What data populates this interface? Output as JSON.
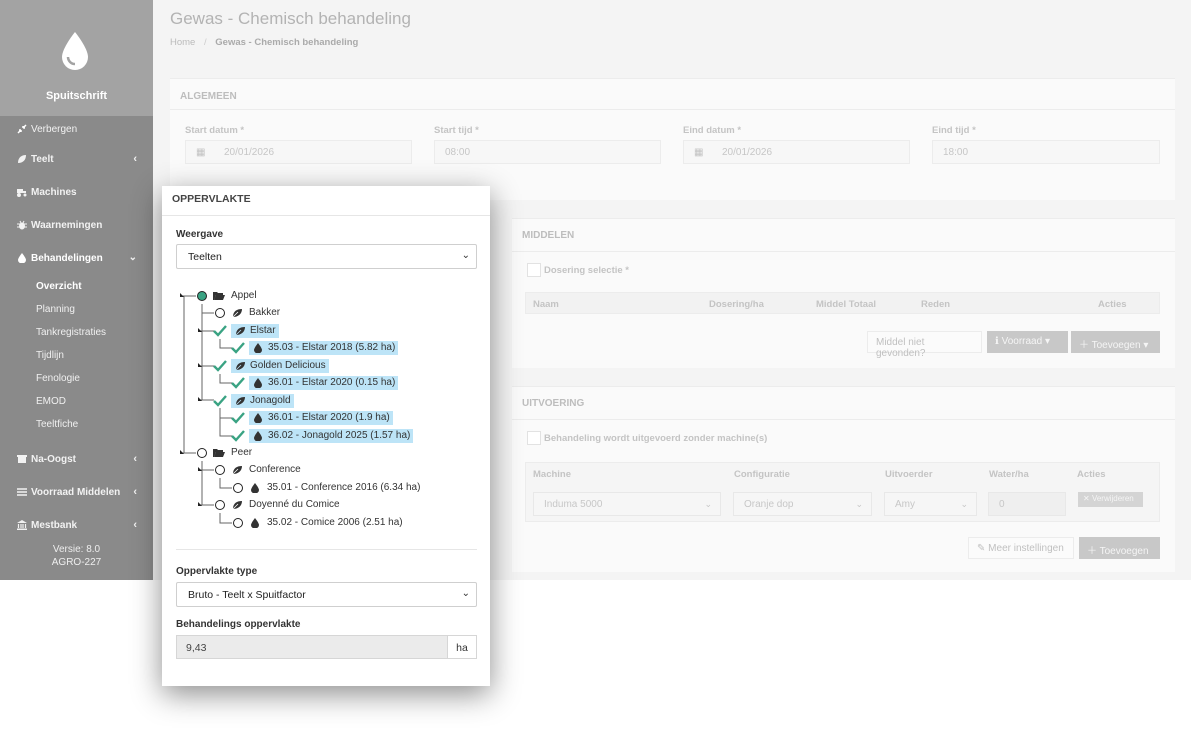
{
  "app": {
    "brand": "Spuitschrift",
    "colors": {
      "sidebar": "#8a8a8a",
      "accent": "#3aa383",
      "highlight": "#bde4f7"
    }
  },
  "sidebar": {
    "hide_label": "Verbergen",
    "items": [
      {
        "label": "Teelt",
        "icon": "leaf-icon",
        "has_children": true
      },
      {
        "label": "Machines",
        "icon": "tractor-icon",
        "has_children": false
      },
      {
        "label": "Waarnemingen",
        "icon": "bug-icon",
        "has_children": false
      },
      {
        "label": "Behandelingen",
        "icon": "drop-icon",
        "has_children": true,
        "expanded": true
      },
      {
        "label": "Na-Oogst",
        "icon": "box-icon",
        "has_children": true
      },
      {
        "label": "Voorraad Middelen",
        "icon": "list-icon",
        "has_children": true
      },
      {
        "label": "Mestbank",
        "icon": "bank-icon",
        "has_children": true
      }
    ],
    "sub_items": [
      "Overzicht",
      "Planning",
      "Tankregistraties",
      "Tijdlijn",
      "Fenologie",
      "EMOD",
      "Teeltfiche"
    ],
    "active_sub": "Overzicht",
    "version": "Versie: 8.0",
    "build": "AGRO-227"
  },
  "header": {
    "title": "Gewas - Chemisch behandeling",
    "breadcrumb_home": "Home",
    "breadcrumb_sep": "/",
    "breadcrumb_current": "Gewas - Chemisch behandeling"
  },
  "algemeen": {
    "title": "ALGEMEEN",
    "start_datum_label": "Start datum *",
    "start_datum": "20/01/2026",
    "start_tijd_label": "Start tijd *",
    "start_tijd": "08:00",
    "eind_datum_label": "Eind datum *",
    "eind_datum": "20/01/2026",
    "eind_tijd_label": "Eind tijd *",
    "eind_tijd": "18:00"
  },
  "middelen": {
    "title": "MIDDELEN",
    "dosering_selectie": "Dosering selectie *",
    "columns": [
      "Naam",
      "Dosering/ha",
      "Middel Totaal",
      "Reden",
      "Acties"
    ],
    "not_found_label": "Middel niet gevonden?",
    "voorraad_label": "Voorraad",
    "toevoegen_label": "Toevoegen"
  },
  "uitvoering": {
    "title": "UITVOERING",
    "zonder_machine": "Behandeling wordt uitgevoerd zonder machine(s)",
    "columns": [
      "Machine",
      "Configuratie",
      "Uitvoerder",
      "Water/ha",
      "Acties"
    ],
    "row": {
      "machine": "Induma 5000",
      "configuratie": "Oranje dop",
      "uitvoerder": "Amy",
      "water": "0",
      "action": "Verwijderen"
    },
    "meer_label": "Meer instellingen",
    "toevoegen_label": "Toevoegen"
  },
  "popup": {
    "title": "OPPERVLAKTE",
    "weergave_label": "Weergave",
    "weergave_value": "Teelten",
    "tree": [
      {
        "label": "Appel",
        "level": 0,
        "state": "partial",
        "icon": "folder-icon"
      },
      {
        "label": "Bakker",
        "level": 1,
        "state": "empty",
        "icon": "leaf-icon"
      },
      {
        "label": "Elstar",
        "level": 1,
        "state": "checked",
        "icon": "leaf-icon",
        "highlight": true
      },
      {
        "label": "35.03 - Elstar 2018 (5.82 ha)",
        "level": 2,
        "state": "checked",
        "icon": "drop-icon",
        "highlight": true
      },
      {
        "label": "Golden Delicious",
        "level": 1,
        "state": "checked",
        "icon": "leaf-icon",
        "highlight": true
      },
      {
        "label": "36.01 - Elstar 2020 (0.15 ha)",
        "level": 2,
        "state": "checked",
        "icon": "drop-icon",
        "highlight": true
      },
      {
        "label": "Jonagold",
        "level": 1,
        "state": "checked",
        "icon": "leaf-icon",
        "highlight": true
      },
      {
        "label": "36.01 - Elstar 2020 (1.9 ha)",
        "level": 2,
        "state": "checked",
        "icon": "drop-icon",
        "highlight": true
      },
      {
        "label": "36.02 - Jonagold 2025 (1.57 ha)",
        "level": 2,
        "state": "checked",
        "icon": "drop-icon",
        "highlight": true
      },
      {
        "label": "Peer",
        "level": 0,
        "state": "empty",
        "icon": "folder-icon"
      },
      {
        "label": "Conference",
        "level": 1,
        "state": "empty",
        "icon": "leaf-icon"
      },
      {
        "label": "35.01 - Conference 2016 (6.34 ha)",
        "level": 2,
        "state": "empty",
        "icon": "drop-icon"
      },
      {
        "label": "Doyenné du Comice",
        "level": 1,
        "state": "empty",
        "icon": "leaf-icon"
      },
      {
        "label": "35.02 - Comice 2006 (2.51 ha)",
        "level": 2,
        "state": "empty",
        "icon": "drop-icon"
      }
    ],
    "type_label": "Oppervlakte type",
    "type_value": "Bruto - Teelt x Spuitfactor",
    "behandel_label": "Behandelings oppervlakte",
    "behandel_value": "9,43",
    "unit": "ha"
  }
}
